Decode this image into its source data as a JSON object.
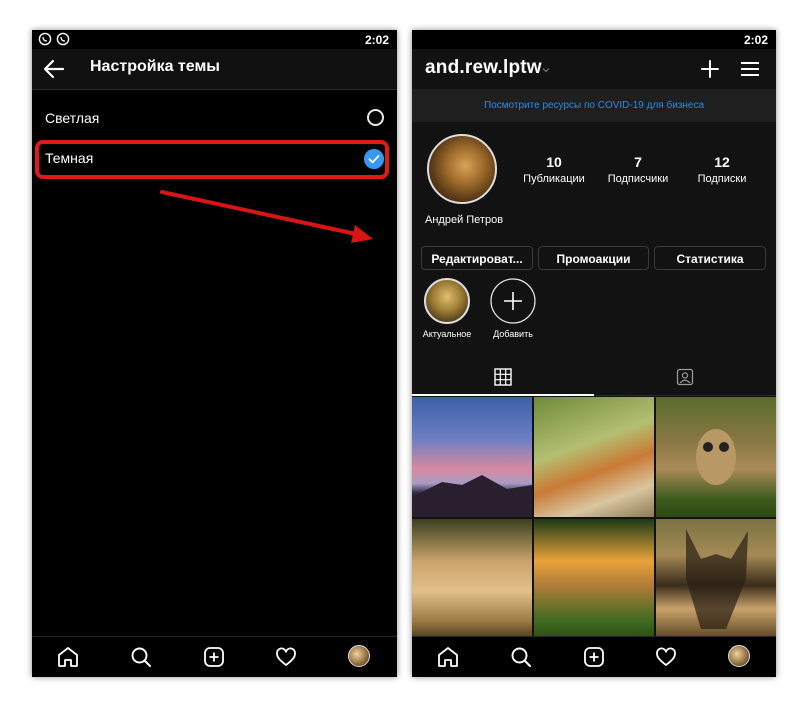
{
  "status": {
    "time": "2:02"
  },
  "theme_screen": {
    "title": "Настройка темы",
    "options": [
      {
        "label": "Светлая",
        "selected": false
      },
      {
        "label": "Темная",
        "selected": true
      }
    ]
  },
  "profile": {
    "username": "and.rew.lptw",
    "covid_banner": "Посмотрите ресурсы по COVID-19 для бизнеса",
    "stats": [
      {
        "count": "10",
        "label": "Публикации"
      },
      {
        "count": "7",
        "label": "Подписчики"
      },
      {
        "count": "12",
        "label": "Подписки"
      }
    ],
    "full_name": "Андрей Петров",
    "buttons": {
      "edit": "Редактироват...",
      "promo": "Промоакции",
      "stats": "Статистика"
    },
    "highlights": [
      {
        "label": "Актуальное"
      },
      {
        "label": "Добавить"
      }
    ]
  },
  "colors": {
    "accent_blue": "#3897f0",
    "highlight_red": "#e01919",
    "link_blue": "#1f8ef5",
    "bg_dark": "#121212"
  },
  "icons": {
    "nav": [
      "home-icon",
      "search-icon",
      "add-post-icon",
      "heart-icon",
      "profile-avatar"
    ],
    "header": [
      "back-arrow-icon",
      "plus-icon",
      "menu-icon"
    ],
    "tabs": [
      "grid-icon",
      "tagged-icon"
    ]
  }
}
